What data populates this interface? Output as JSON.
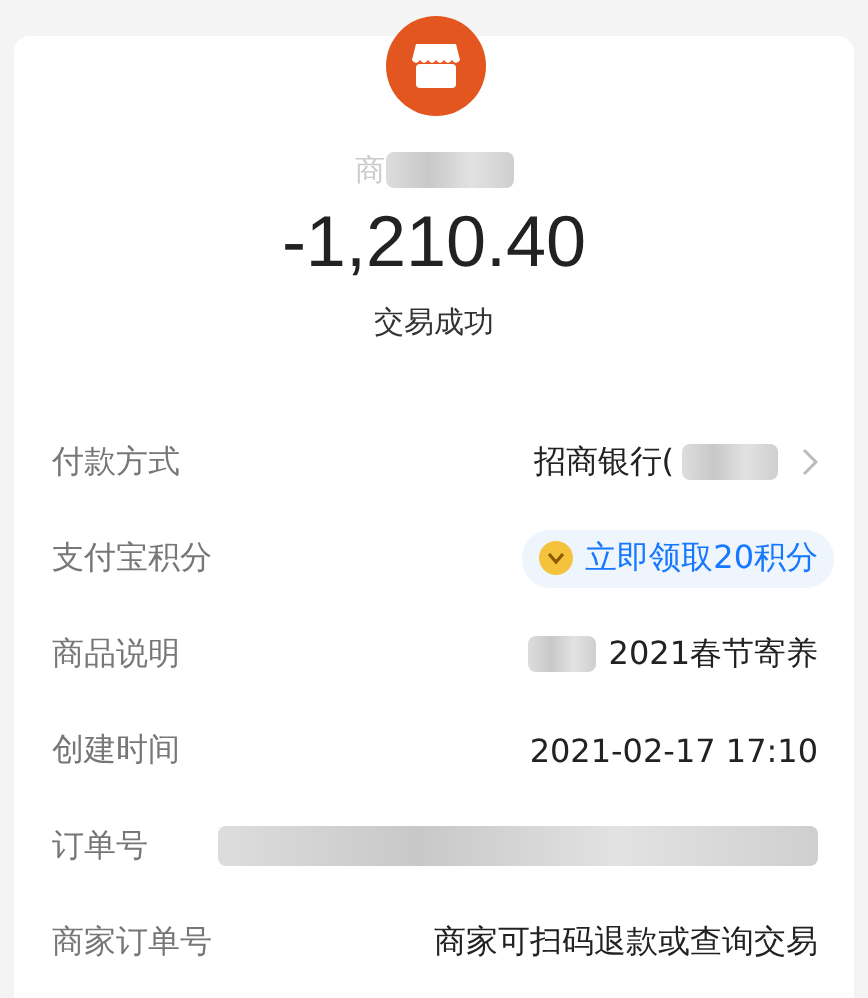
{
  "merchant": {
    "name": "商",
    "redacted": true
  },
  "amount": "-1,210.40",
  "status": "交易成功",
  "rows": [
    {
      "label": "付款方式",
      "kind": "link",
      "value": "招商银行(",
      "redacted": true
    },
    {
      "label": "支付宝积分",
      "kind": "points",
      "value": "立即领取20积分"
    },
    {
      "label": "商品说明",
      "kind": "text",
      "value": "2021春节寄养",
      "redacted_before": true
    },
    {
      "label": "创建时间",
      "kind": "text",
      "value": "2021-02-17 17:10"
    },
    {
      "label": "订单号",
      "kind": "hidden"
    },
    {
      "label": "商家订单号",
      "kind": "text",
      "value": "商家可扫码退款或查询交易"
    }
  ]
}
